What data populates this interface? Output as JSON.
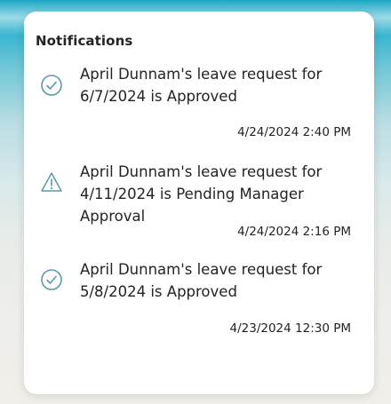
{
  "panel": {
    "title": "Notifications"
  },
  "notifications": [
    {
      "icon": "check-circle-icon",
      "message": "April Dunnam's leave request for 6/7/2024 is Approved",
      "timestamp": "4/24/2024 2:40 PM"
    },
    {
      "icon": "warning-triangle-icon",
      "message": "April Dunnam's leave request for 4/11/2024 is Pending Manager Approval",
      "timestamp": "4/24/2024 2:16 PM"
    },
    {
      "icon": "check-circle-icon",
      "message": "April Dunnam's leave request for 5/8/2024 is Approved",
      "timestamp": "4/23/2024 12:30 PM"
    }
  ],
  "colors": {
    "icon": "#5b9aa8",
    "text": "#242424",
    "card": "#ffffff"
  }
}
